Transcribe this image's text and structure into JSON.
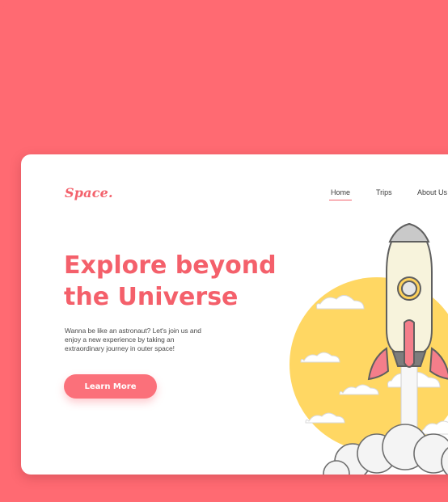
{
  "brand": {
    "logo": "Space."
  },
  "nav": {
    "home": "Home",
    "trips": "Trips",
    "about": "About Us"
  },
  "hero": {
    "title": "Explore beyond the Universe",
    "description": "Wanna be like an astronaut? Let's join us and enjoy a new experience by taking an extraordinary journey in outer space!",
    "cta_label": "Learn More"
  },
  "colors": {
    "background": "#ff6a72",
    "accent": "#f4606b",
    "sun": "#ffd763",
    "rocket_body": "#f7f3dc"
  }
}
